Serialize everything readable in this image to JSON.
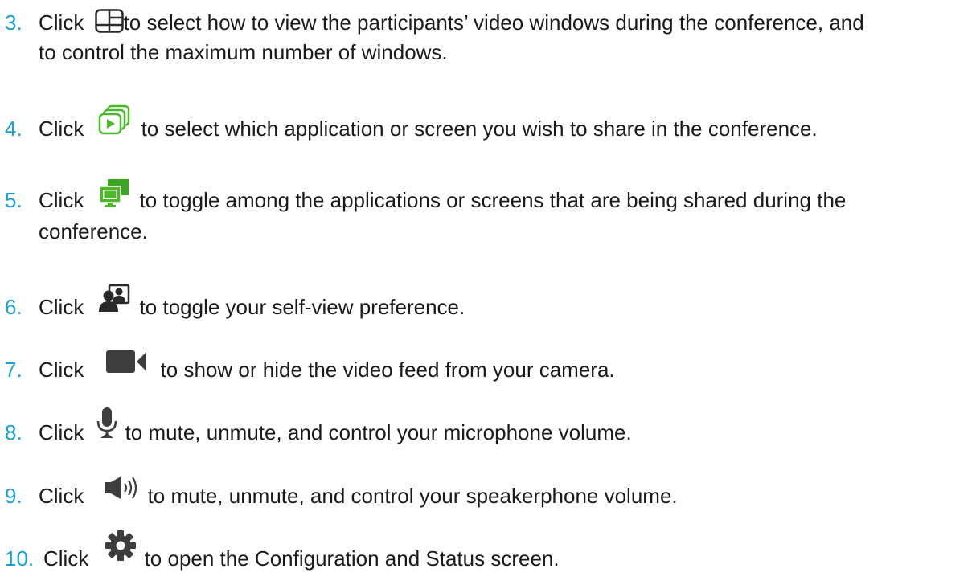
{
  "steps": [
    {
      "number": "3.",
      "click": "Click",
      "icon": "grid-layout-icon",
      "text_line1": "to select how to view the participants’ video windows during the conference, and",
      "text_line2": "to control the maximum number of windows."
    },
    {
      "number": "4.",
      "click": "Click",
      "icon": "share-content-icon",
      "text_line1": "to select which application or screen you wish to share in the conference."
    },
    {
      "number": "5.",
      "click": "Click",
      "icon": "toggle-shared-screens-icon",
      "text_line1": "to toggle among the applications or screens that are being shared during the",
      "text_line2": "conference."
    },
    {
      "number": "6.",
      "click": "Click",
      "icon": "self-view-icon",
      "text_line1": "to toggle your self-view preference."
    },
    {
      "number": "7.",
      "click": "Click",
      "icon": "camera-icon",
      "text_line1": "to show or hide the video feed from your camera."
    },
    {
      "number": "8.",
      "click": "Click",
      "icon": "microphone-icon",
      "text_line1": "to mute, unmute, and control your microphone volume."
    },
    {
      "number": "9.",
      "click": "Click",
      "icon": "speaker-icon",
      "text_line1": "to mute, unmute, and control your speakerphone volume."
    },
    {
      "number": "10.",
      "click": "Click",
      "icon": "gear-icon",
      "text_line1": "to open the Configuration and Status screen."
    }
  ],
  "colors": {
    "step_number": "#1aa0d8",
    "body_text": "#1a1a1a",
    "share_icon_green": "#4cb82a",
    "icon_gray": "#3d3d3d"
  }
}
